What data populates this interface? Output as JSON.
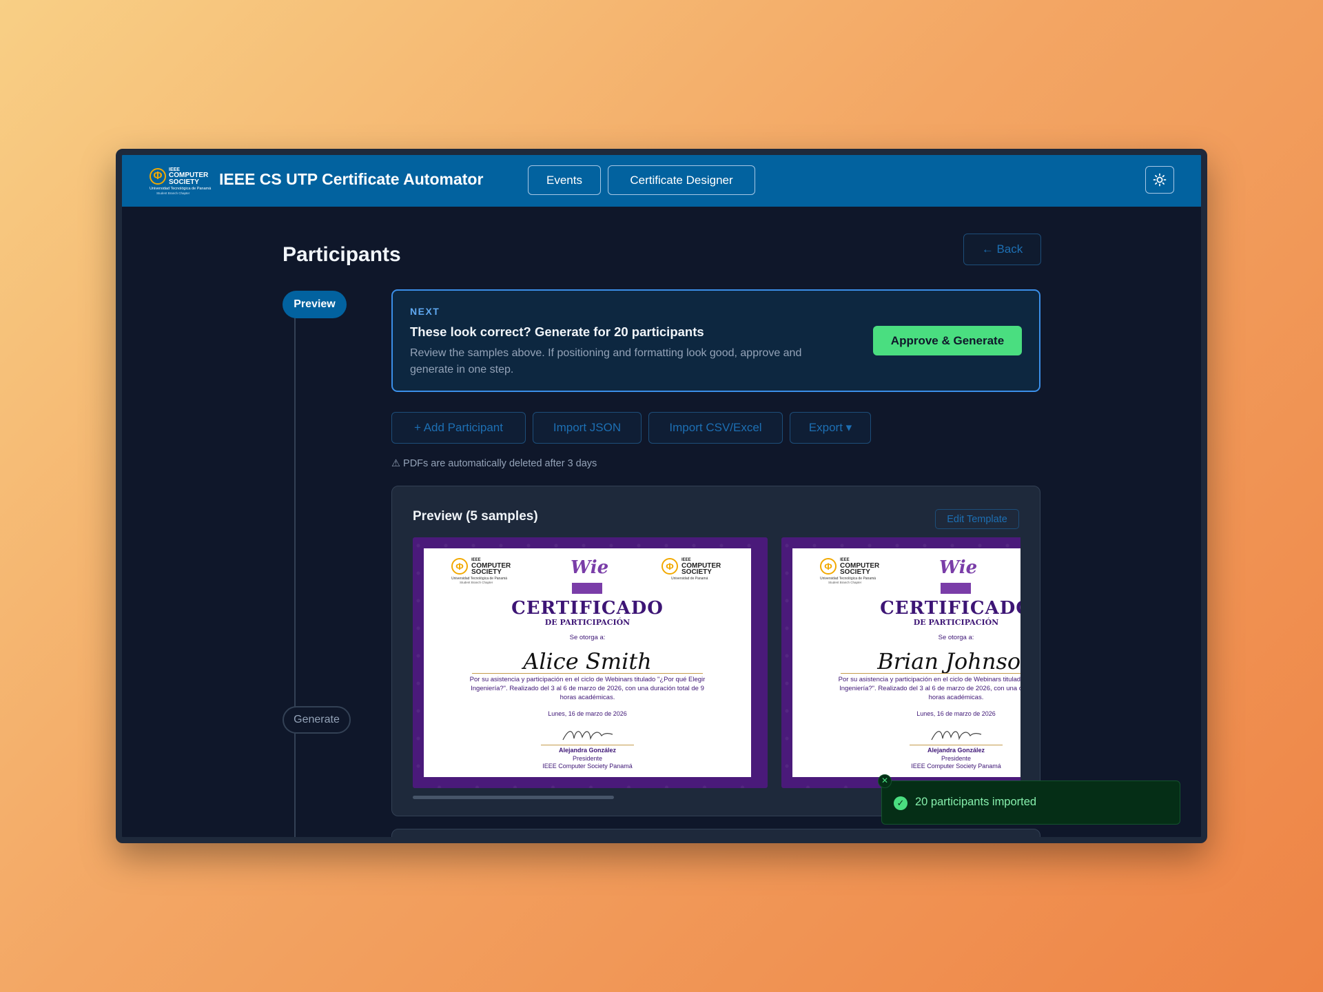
{
  "header": {
    "logo": {
      "line1": "IEEE",
      "line2": "COMPUTER SOCIETY",
      "line3": "Universidad Tecnológica de Panamá",
      "line4": "Student Branch Chapter"
    },
    "app_title": "IEEE CS UTP Certificate Automator",
    "nav": [
      {
        "label": "Events"
      },
      {
        "label": "Certificate Designer"
      }
    ],
    "theme_icon": "sun-icon"
  },
  "page": {
    "title": "Participants",
    "back_label": "← Back"
  },
  "timeline": {
    "steps": [
      {
        "label": "Preview",
        "active": true
      },
      {
        "label": "Generate",
        "active": false
      }
    ]
  },
  "next_card": {
    "kicker": "NEXT",
    "title": "These look correct? Generate for 20 participants",
    "description": "Review the samples above. If positioning and formatting look good, approve and generate in one step.",
    "action_label": "Approve & Generate"
  },
  "actions": [
    {
      "label": "+ Add Participant"
    },
    {
      "label": "Import JSON"
    },
    {
      "label": "Import CSV/Excel"
    },
    {
      "label": "Export ▾"
    }
  ],
  "notice": "⚠ PDFs are automatically deleted after 3 days",
  "preview": {
    "title": "Preview (5 samples)",
    "edit_label": "Edit Template",
    "certificates": [
      {
        "logo_left_1": "IEEE",
        "logo_left_2": "COMPUTER SOCIETY",
        "logo_left_3": "Universidad Tecnológica de Panamá",
        "logo_left_4": "Student Branch Chapter",
        "wie": "Wie",
        "logo_right_1": "IEEE",
        "logo_right_2": "COMPUTER SOCIETY",
        "logo_right_3": "Universidad de Panamá",
        "title": "CERTIFICADO",
        "subtitle": "DE PARTICIPACIÓN",
        "granted": "Se otorga a:",
        "name": "Alice Smith",
        "body": "Por su asistencia y participación en el ciclo de Webinars titulado \"¿Por qué Elegir Ingeniería?\". Realizado del 3 al 6 de marzo de 2026, con una duración total de 9 horas académicas.",
        "date": "Lunes, 16 de marzo de 2026",
        "signer": "Alejandra González",
        "role": "Presidente",
        "org": "IEEE Computer Society Panamá"
      },
      {
        "logo_left_1": "IEEE",
        "logo_left_2": "COMPUTER SOCIETY",
        "logo_left_3": "Universidad Tecnológica de Panamá",
        "logo_left_4": "Student Branch Chapter",
        "wie": "Wie",
        "title": "CERTIFICADO",
        "subtitle": "DE PARTICIPACIÓN",
        "granted": "Se otorga a:",
        "name": "Brian Johnson",
        "body": "Por su asistencia y participación en el ciclo de Webinars titulado \"¿Por qué Elegir Ingeniería?\". Realizado del 3 al 6 de marzo de 2026, con una duración total de 9 horas académicas.",
        "date": "Lunes, 16 de marzo de 2026",
        "signer": "Alejandra González",
        "role": "Presidente",
        "org": "IEEE Computer Society Panamá"
      }
    ]
  },
  "toast": {
    "message": "20 participants imported",
    "close_icon": "close-icon",
    "status_icon": "check-circle-icon"
  },
  "colors": {
    "header": "#02629f",
    "accent": "#1d6fb3",
    "success": "#4ade80",
    "background": "#0f172a",
    "certificate_purple": "#4a1a7a"
  }
}
